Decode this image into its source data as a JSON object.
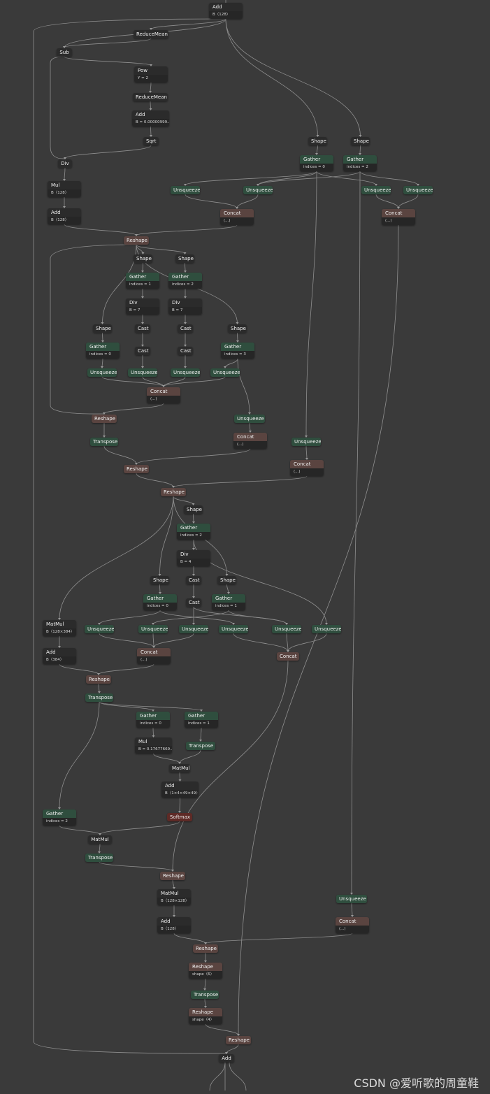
{
  "watermark": "CSDN @爱听歌的周童鞋",
  "nodes": [
    {
      "id": "n_add_top",
      "op": "Add",
      "attr": "B〈128〉",
      "type": "plain"
    },
    {
      "id": "n_rm1",
      "op": "ReduceMean",
      "type": "plain"
    },
    {
      "id": "n_sub",
      "op": "Sub",
      "type": "plain"
    },
    {
      "id": "n_pow",
      "op": "Pow",
      "attr": "Y = 2",
      "type": "plain"
    },
    {
      "id": "n_rm2",
      "op": "ReduceMean",
      "type": "plain"
    },
    {
      "id": "n_add_eps",
      "op": "Add",
      "attr": "B = 0.00000999...",
      "type": "plain"
    },
    {
      "id": "n_sqrt",
      "op": "Sqrt",
      "type": "plain"
    },
    {
      "id": "n_div_ln",
      "op": "Div",
      "type": "plain"
    },
    {
      "id": "n_mul_ln",
      "op": "Mul",
      "attr": "B〈128〉",
      "type": "plain"
    },
    {
      "id": "n_add_ln",
      "op": "Add",
      "attr": "B〈128〉",
      "type": "plain"
    },
    {
      "id": "n_shape_a",
      "op": "Shape",
      "type": "plain"
    },
    {
      "id": "n_shape_b",
      "op": "Shape",
      "type": "plain"
    },
    {
      "id": "n_gather_a",
      "op": "Gather",
      "attr": "indices = 0",
      "type": "green"
    },
    {
      "id": "n_gather_b",
      "op": "Gather",
      "attr": "indices = 2",
      "type": "green"
    },
    {
      "id": "n_unsq_1",
      "op": "Unsqueeze",
      "type": "green"
    },
    {
      "id": "n_unsq_2",
      "op": "Unsqueeze",
      "type": "green"
    },
    {
      "id": "n_unsq_3",
      "op": "Unsqueeze",
      "type": "green"
    },
    {
      "id": "n_unsq_4",
      "op": "Unsqueeze",
      "type": "green"
    },
    {
      "id": "n_concat_1",
      "op": "Concat",
      "attr": "(...)",
      "type": "brown"
    },
    {
      "id": "n_concat_2",
      "op": "Concat",
      "attr": "(...)",
      "type": "brown"
    },
    {
      "id": "n_reshape_1",
      "op": "Reshape",
      "type": "brown"
    },
    {
      "id": "n_shape_c",
      "op": "Shape",
      "type": "plain"
    },
    {
      "id": "n_shape_d",
      "op": "Shape",
      "type": "plain"
    },
    {
      "id": "n_gather_c",
      "op": "Gather",
      "attr": "indices = 1",
      "type": "green"
    },
    {
      "id": "n_gather_d",
      "op": "Gather",
      "attr": "indices = 2",
      "type": "green"
    },
    {
      "id": "n_div_c",
      "op": "Div",
      "attr": "B = 7",
      "type": "plain"
    },
    {
      "id": "n_div_d",
      "op": "Div",
      "attr": "B = 7",
      "type": "plain"
    },
    {
      "id": "n_shape_e",
      "op": "Shape",
      "type": "plain"
    },
    {
      "id": "n_cast_1",
      "op": "Cast",
      "type": "plain"
    },
    {
      "id": "n_cast_2",
      "op": "Cast",
      "type": "plain"
    },
    {
      "id": "n_shape_f",
      "op": "Shape",
      "type": "plain"
    },
    {
      "id": "n_gather_e",
      "op": "Gather",
      "attr": "indices = 0",
      "type": "green"
    },
    {
      "id": "n_cast_3",
      "op": "Cast",
      "type": "plain"
    },
    {
      "id": "n_cast_4",
      "op": "Cast",
      "type": "plain"
    },
    {
      "id": "n_gather_f",
      "op": "Gather",
      "attr": "indices = 3",
      "type": "green"
    },
    {
      "id": "n_unsq_5",
      "op": "Unsqueeze",
      "type": "green"
    },
    {
      "id": "n_unsq_6",
      "op": "Unsqueeze",
      "type": "green"
    },
    {
      "id": "n_unsq_7",
      "op": "Unsqueeze",
      "type": "green"
    },
    {
      "id": "n_unsq_8",
      "op": "Unsqueeze",
      "type": "green"
    },
    {
      "id": "n_concat_3",
      "op": "Concat",
      "attr": "(...)",
      "type": "brown"
    },
    {
      "id": "n_reshape_2",
      "op": "Reshape",
      "type": "brown"
    },
    {
      "id": "n_unsq_9",
      "op": "Unsqueeze",
      "type": "green"
    },
    {
      "id": "n_transpose_1",
      "op": "Transpose",
      "type": "green"
    },
    {
      "id": "n_concat_4",
      "op": "Concat",
      "attr": "(...)",
      "type": "brown"
    },
    {
      "id": "n_unsq_10",
      "op": "Unsqueeze",
      "type": "green"
    },
    {
      "id": "n_reshape_3",
      "op": "Reshape",
      "type": "brown"
    },
    {
      "id": "n_concat_5",
      "op": "Concat",
      "attr": "(...)",
      "type": "brown"
    },
    {
      "id": "n_reshape_4",
      "op": "Reshape",
      "type": "brown"
    },
    {
      "id": "n_shape_g",
      "op": "Shape",
      "type": "plain"
    },
    {
      "id": "n_gather_g",
      "op": "Gather",
      "attr": "indices = 2",
      "type": "green"
    },
    {
      "id": "n_div_g",
      "op": "Div",
      "attr": "B = 4",
      "type": "plain"
    },
    {
      "id": "n_shape_h",
      "op": "Shape",
      "type": "plain"
    },
    {
      "id": "n_cast_5",
      "op": "Cast",
      "type": "plain"
    },
    {
      "id": "n_shape_i",
      "op": "Shape",
      "type": "plain"
    },
    {
      "id": "n_gather_h",
      "op": "Gather",
      "attr": "indices = 0",
      "type": "green"
    },
    {
      "id": "n_cast_6",
      "op": "Cast",
      "type": "plain"
    },
    {
      "id": "n_gather_i",
      "op": "Gather",
      "attr": "indices = 1",
      "type": "green"
    },
    {
      "id": "n_matmul_qkv",
      "op": "MatMul",
      "attr": "B〈128×384〉",
      "type": "plain"
    },
    {
      "id": "n_unsq_11",
      "op": "Unsqueeze",
      "type": "green"
    },
    {
      "id": "n_unsq_12",
      "op": "Unsqueeze",
      "type": "green"
    },
    {
      "id": "n_unsq_13",
      "op": "Unsqueeze",
      "type": "green"
    },
    {
      "id": "n_unsq_14",
      "op": "Unsqueeze",
      "type": "green"
    },
    {
      "id": "n_unsq_15",
      "op": "Unsqueeze",
      "type": "green"
    },
    {
      "id": "n_unsq_16",
      "op": "Unsqueeze",
      "type": "green"
    },
    {
      "id": "n_add_qkv",
      "op": "Add",
      "attr": "B〈384〉",
      "type": "plain"
    },
    {
      "id": "n_concat_6",
      "op": "Concat",
      "attr": "(...)",
      "type": "brown"
    },
    {
      "id": "n_concat_7",
      "op": "Concat",
      "type": "brown"
    },
    {
      "id": "n_reshape_5",
      "op": "Reshape",
      "type": "brown"
    },
    {
      "id": "n_transpose_2",
      "op": "Transpose",
      "type": "green"
    },
    {
      "id": "n_gather_q",
      "op": "Gather",
      "attr": "indices = 0",
      "type": "green"
    },
    {
      "id": "n_gather_k",
      "op": "Gather",
      "attr": "indices = 1",
      "type": "green"
    },
    {
      "id": "n_mul_scale",
      "op": "Mul",
      "attr": "B = 0.17677669...",
      "type": "plain"
    },
    {
      "id": "n_transpose_k",
      "op": "Transpose",
      "type": "green"
    },
    {
      "id": "n_matmul_qk",
      "op": "MatMul",
      "type": "plain"
    },
    {
      "id": "n_add_bias",
      "op": "Add",
      "attr": "B〈1×4×49×49〉",
      "type": "plain"
    },
    {
      "id": "n_softmax",
      "op": "Softmax",
      "type": "red"
    },
    {
      "id": "n_gather_v",
      "op": "Gather",
      "attr": "indices = 2",
      "type": "green"
    },
    {
      "id": "n_matmul_av",
      "op": "MatMul",
      "type": "plain"
    },
    {
      "id": "n_transpose_3",
      "op": "Transpose",
      "type": "green"
    },
    {
      "id": "n_reshape_6",
      "op": "Reshape",
      "type": "brown"
    },
    {
      "id": "n_matmul_proj",
      "op": "MatMul",
      "attr": "B〈128×128〉",
      "type": "plain"
    },
    {
      "id": "n_unsq_17",
      "op": "Unsqueeze",
      "type": "green"
    },
    {
      "id": "n_add_proj",
      "op": "Add",
      "attr": "B〈128〉",
      "type": "plain"
    },
    {
      "id": "n_concat_8",
      "op": "Concat",
      "attr": "(...)",
      "type": "brown"
    },
    {
      "id": "n_reshape_7",
      "op": "Reshape",
      "type": "brown"
    },
    {
      "id": "n_reshape_8",
      "op": "Reshape",
      "attr": "shape〈6〉",
      "type": "brown"
    },
    {
      "id": "n_transpose_4",
      "op": "Transpose",
      "type": "green"
    },
    {
      "id": "n_reshape_9",
      "op": "Reshape",
      "attr": "shape〈4〉",
      "type": "brown"
    },
    {
      "id": "n_reshape_10",
      "op": "Reshape",
      "type": "brown"
    },
    {
      "id": "n_add_out",
      "op": "Add",
      "type": "plain"
    }
  ]
}
